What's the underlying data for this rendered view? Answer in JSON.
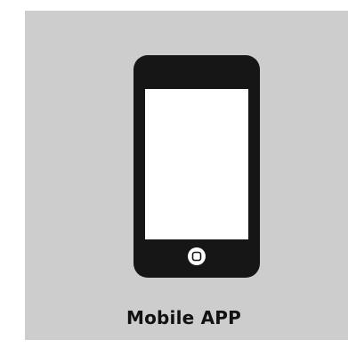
{
  "tile": {
    "label": "Mobile APP",
    "icon": "smartphone-icon",
    "colors": {
      "background": "#cdcdcd",
      "device": "#161616",
      "screen": "#ffffff",
      "text": "#111111"
    }
  }
}
